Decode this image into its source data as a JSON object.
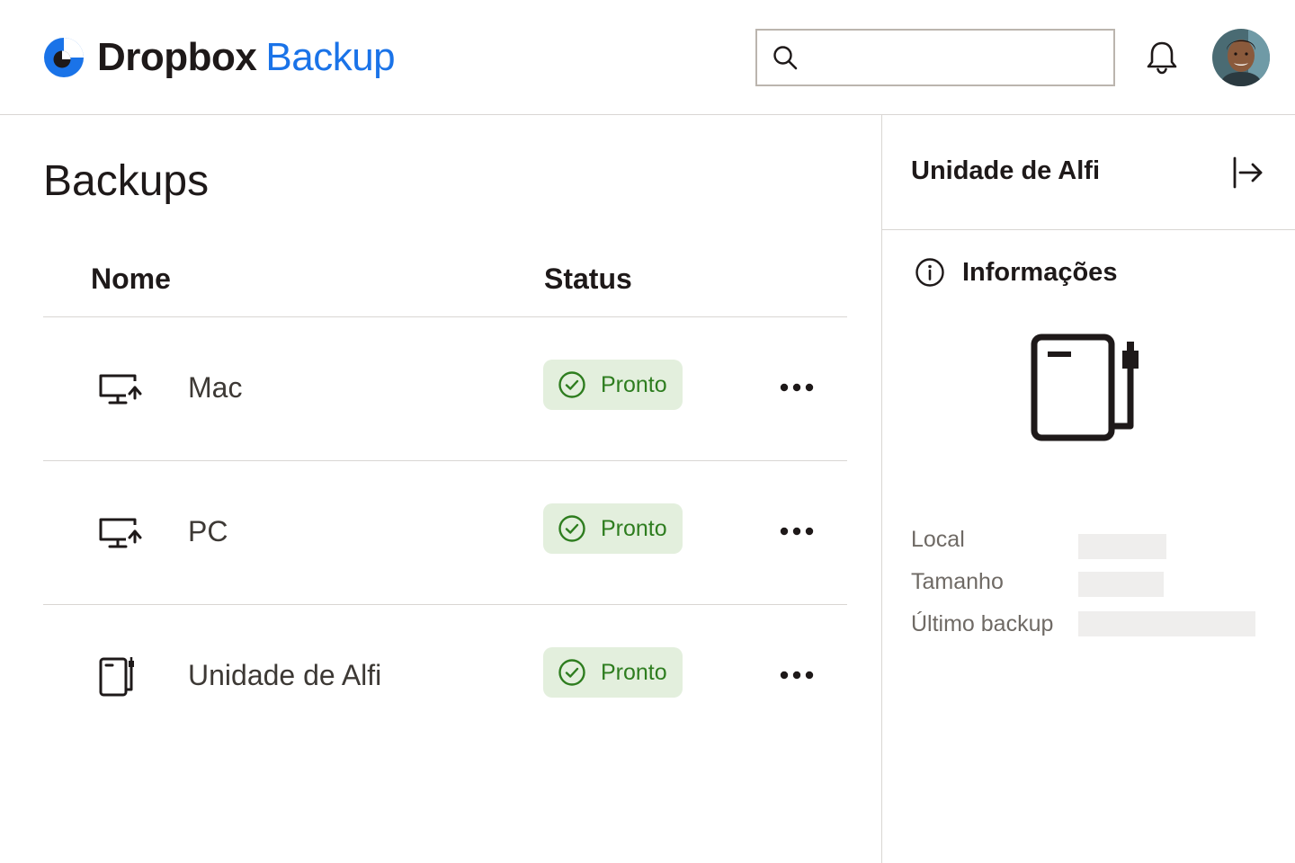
{
  "app": {
    "brand": "Dropbox",
    "product": "Backup",
    "colors": {
      "accent": "#1a73e8",
      "success_bg": "#e3efdd",
      "success_fg": "#2e7d1f"
    }
  },
  "header": {
    "search": {
      "placeholder": "",
      "value": "",
      "icon": "search-icon"
    },
    "notifications_icon": "bell-icon",
    "avatar_icon": "user-avatar"
  },
  "main": {
    "title": "Backups",
    "columns": {
      "name": "Nome",
      "status": "Status"
    },
    "rows": [
      {
        "name": "Mac",
        "icon": "monitor-backup-icon",
        "status": "Pronto"
      },
      {
        "name": "PC",
        "icon": "monitor-backup-icon",
        "status": "Pronto"
      },
      {
        "name": "Unidade de Alfi",
        "icon": "external-drive-icon",
        "status": "Pronto"
      }
    ]
  },
  "panel": {
    "title": "Unidade de Alfi",
    "close_icon": "collapse-right-icon",
    "info_heading": "Informações",
    "device_icon": "external-drive-icon",
    "meta": [
      {
        "label": "Local",
        "value": ""
      },
      {
        "label": "Tamanho",
        "value": ""
      },
      {
        "label": "Último backup",
        "value": ""
      }
    ]
  }
}
